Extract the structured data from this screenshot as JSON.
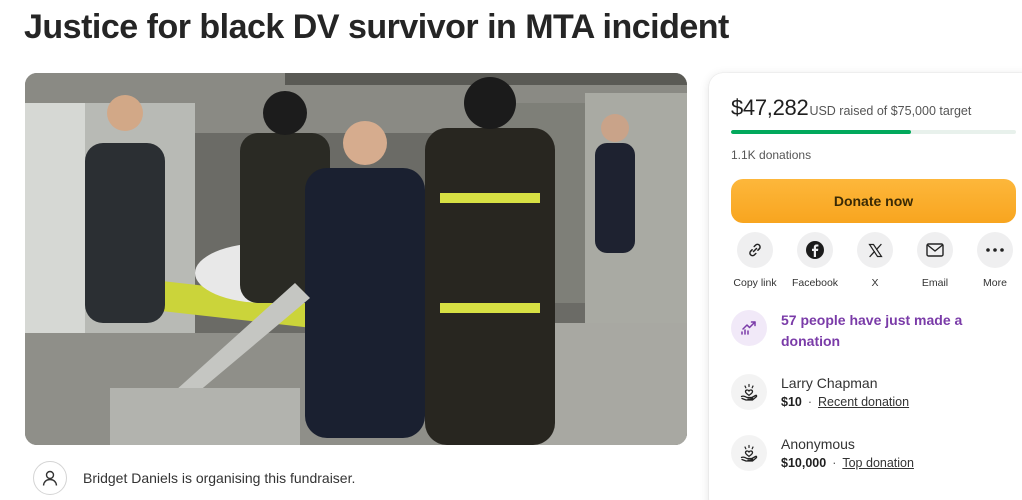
{
  "page": {
    "title": "Justice for black DV survivor in MTA incident"
  },
  "organiser": {
    "text": "Bridget Daniels is organising this fundraiser."
  },
  "fundraiser": {
    "amount_raised": "$47,282",
    "amount_suffix": "USD raised of $75,000 target",
    "progress_fraction": 0.63,
    "donation_count": "1.1K donations",
    "donate_label": "Donate now"
  },
  "share": [
    {
      "label": "Copy link",
      "icon": "link-icon"
    },
    {
      "label": "Facebook",
      "icon": "facebook-icon"
    },
    {
      "label": "X",
      "icon": "x-icon"
    },
    {
      "label": "Email",
      "icon": "email-icon"
    },
    {
      "label": "More",
      "icon": "more-icon"
    }
  ],
  "recent_alert": {
    "text": "57 people have just made a donation"
  },
  "donations": [
    {
      "name": "Larry Chapman",
      "amount": "$10",
      "tag": "Recent donation"
    },
    {
      "name": "Anonymous",
      "amount": "$10,000",
      "tag": "Top donation"
    }
  ],
  "colors": {
    "progress": "#02a95c",
    "donate_button": "#f8a51f",
    "alert_text": "#7a3ba8"
  }
}
